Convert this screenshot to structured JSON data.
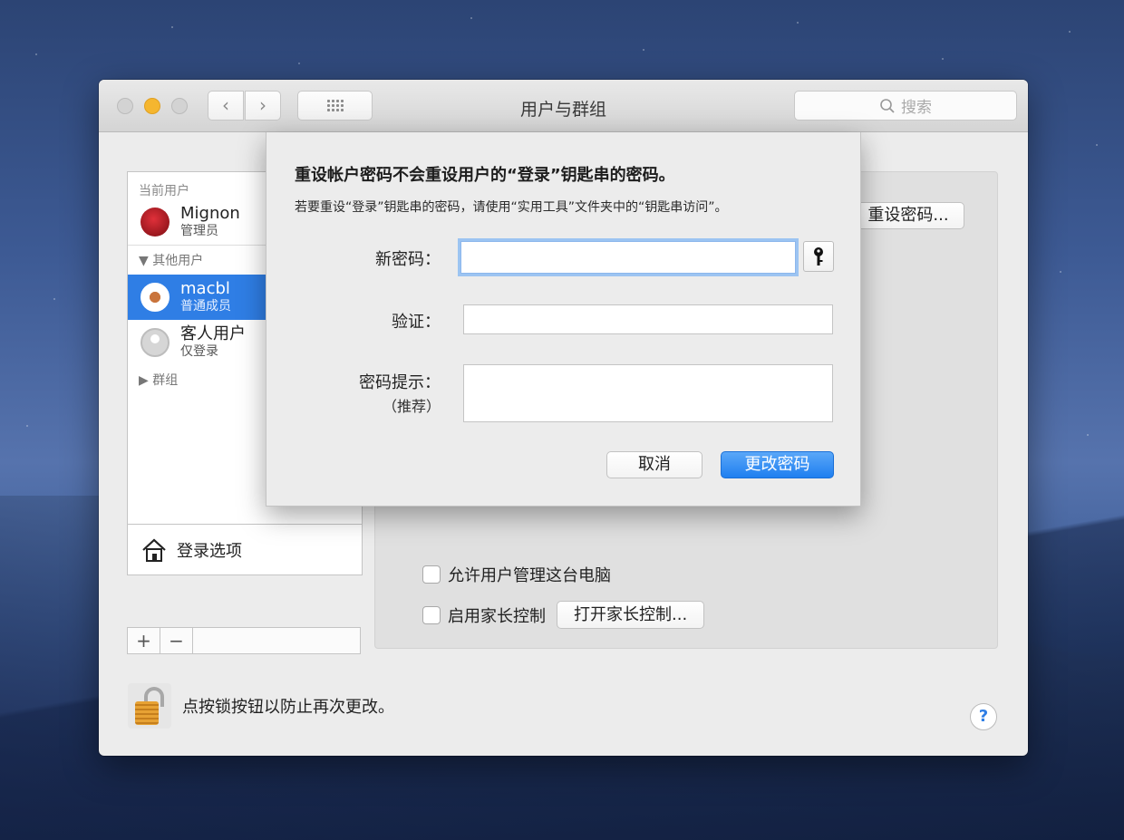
{
  "window": {
    "title": "用户与群组",
    "search_placeholder": "搜索"
  },
  "sidebar": {
    "current_user_label": "当前用户",
    "current_user": {
      "name": "Mignon",
      "role": "管理员"
    },
    "other_users_label": "其他用户",
    "other_users": [
      {
        "name": "macbl",
        "role": "普通成员"
      },
      {
        "name": "客人用户",
        "role": "仅登录"
      }
    ],
    "groups_label": "群组",
    "login_options": "登录选项",
    "add": "+",
    "remove": "−"
  },
  "main": {
    "reset_password_button": "重设密码...",
    "allow_admin_label": "允许用户管理这台电脑",
    "parental_label": "启用家长控制",
    "open_parental_button": "打开家长控制..."
  },
  "footer": {
    "lock_text": "点按锁按钮以防止再次更改。",
    "help": "?"
  },
  "sheet": {
    "title": "重设帐户密码不会重设用户的“登录”钥匙串的密码。",
    "subtitle": "若要重设“登录”钥匙串的密码，请使用“实用工具”文件夹中的“钥匙串访问”。",
    "new_password_label": "新密码：",
    "verify_label": "验证：",
    "hint_label": "密码提示：",
    "hint_sub": "（推荐）",
    "cancel": "取消",
    "confirm": "更改密码"
  }
}
